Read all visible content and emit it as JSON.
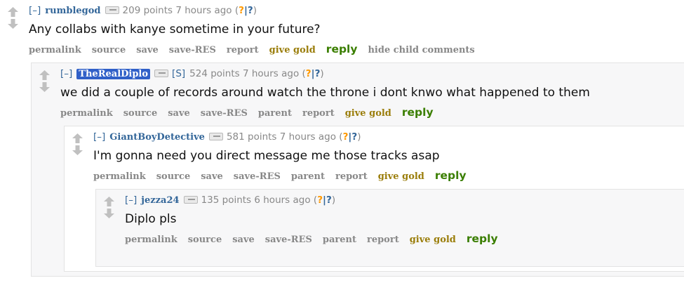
{
  "colors": {
    "link_blue": "#336699",
    "meta_gray": "#888888",
    "gold": "#9a7d0a",
    "reply_green": "#3a7e00",
    "op_badge": "#3060c8",
    "vote_arrow": "#c0c0c0"
  },
  "comments": [
    {
      "expand": "[–]",
      "author": "rumblegod",
      "points": "209 points 7 hours ago",
      "q1": "?",
      "sep": "|",
      "q2": "?",
      "body": "Any collabs with kanye sometime in your future?",
      "buttons": {
        "permalink": "permalink",
        "source": "source",
        "save": "save",
        "save_res": "save-RES",
        "report": "report",
        "give_gold": "give gold",
        "reply": "reply",
        "hide_child": "hide child comments"
      }
    },
    {
      "expand": "[–]",
      "author": "TheRealDiplo",
      "submitter": "[S]",
      "points": "524 points 7 hours ago",
      "q1": "?",
      "sep": "|",
      "q2": "?",
      "body": "we did a couple of records around watch the throne i dont knwo what happened to them",
      "buttons": {
        "permalink": "permalink",
        "source": "source",
        "save": "save",
        "save_res": "save-RES",
        "parent": "parent",
        "report": "report",
        "give_gold": "give gold",
        "reply": "reply"
      }
    },
    {
      "expand": "[–]",
      "author": "GiantBoyDetective",
      "points": "581 points 7 hours ago",
      "q1": "?",
      "sep": "|",
      "q2": "?",
      "body": "I'm gonna need you direct message me those tracks asap",
      "buttons": {
        "permalink": "permalink",
        "source": "source",
        "save": "save",
        "save_res": "save-RES",
        "parent": "parent",
        "report": "report",
        "give_gold": "give gold",
        "reply": "reply"
      }
    },
    {
      "expand": "[–]",
      "author": "jezza24",
      "points": "135 points 6 hours ago",
      "q1": "?",
      "sep": "|",
      "q2": "?",
      "body": "Diplo pls",
      "buttons": {
        "permalink": "permalink",
        "source": "source",
        "save": "save",
        "save_res": "save-RES",
        "parent": "parent",
        "report": "report",
        "give_gold": "give gold",
        "reply": "reply"
      }
    }
  ]
}
